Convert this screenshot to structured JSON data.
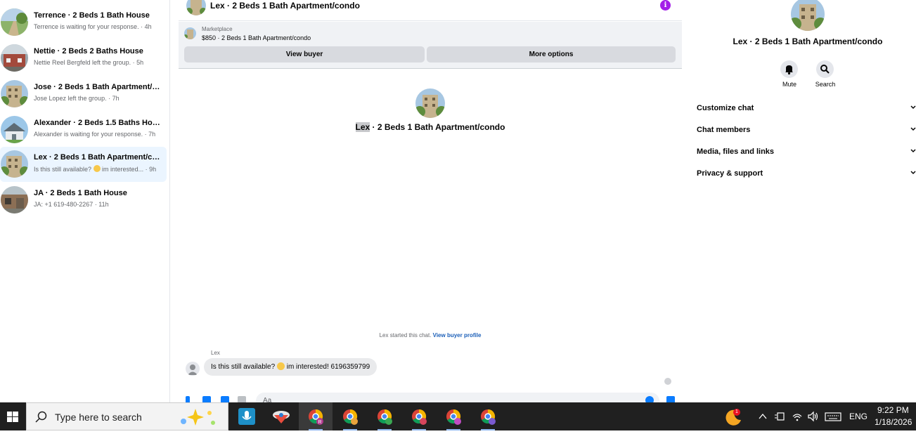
{
  "conversations": [
    {
      "title": "Terrence · 2 Beds 1 Bath House",
      "subtitle": "Terrence is waiting for your response. · 4h",
      "active": false
    },
    {
      "title": "Nettie · 2 Beds 2 Baths House",
      "subtitle": "Nettie Reel Bergfeld left the group. · 5h",
      "active": false
    },
    {
      "title": "Jose · 2 Beds 1 Bath Apartment/co...",
      "subtitle": "Jose Lopez left the group. · 7h",
      "active": false
    },
    {
      "title": "Alexander · 2 Beds 1.5 Baths House",
      "subtitle": "Alexander is waiting for your response. · 7h",
      "active": false
    },
    {
      "title": "Lex · 2 Beds 1 Bath Apartment/con...",
      "subtitle_a": "Is this still available? ",
      "subtitle_b": " im interested... · 9h",
      "active": true
    },
    {
      "title": "JA · 2 Beds 1 Bath House",
      "subtitle": "JA: +1 619-480-2267 · 11h",
      "active": false
    }
  ],
  "chat": {
    "header_title": "Lex · 2 Beds 1 Bath Apartment/condo",
    "marketplace_label": "Marketplace",
    "listing": "$850 · 2 Beds 1 Bath Apartment/condo",
    "view_buyer": "View buyer",
    "more_options": "More options",
    "center_name": "Lex",
    "center_rest": " · 2 Beds 1 Bath Apartment/condo",
    "started_text": "Lex started this chat. ",
    "started_link": "View buyer profile",
    "sender": "Lex",
    "message_a": "Is this still available? ",
    "message_b": " im interested! 6196359799",
    "composer_placeholder": "Aa"
  },
  "info_panel": {
    "title": "Lex · 2 Beds 1 Bath Apartment/condo",
    "mute": "Mute",
    "search": "Search",
    "menu": [
      "Customize chat",
      "Chat members",
      "Media, files and links",
      "Privacy & support"
    ]
  },
  "taskbar": {
    "search_placeholder": "Type here to search",
    "language": "ENG",
    "time": "9:22 PM",
    "date": "1/18/2026",
    "notification_count": "1"
  },
  "colors": {
    "accent_purple": "#a31ee8",
    "link_blue": "#1b5fb8",
    "active_row": "#ebf5ff"
  }
}
